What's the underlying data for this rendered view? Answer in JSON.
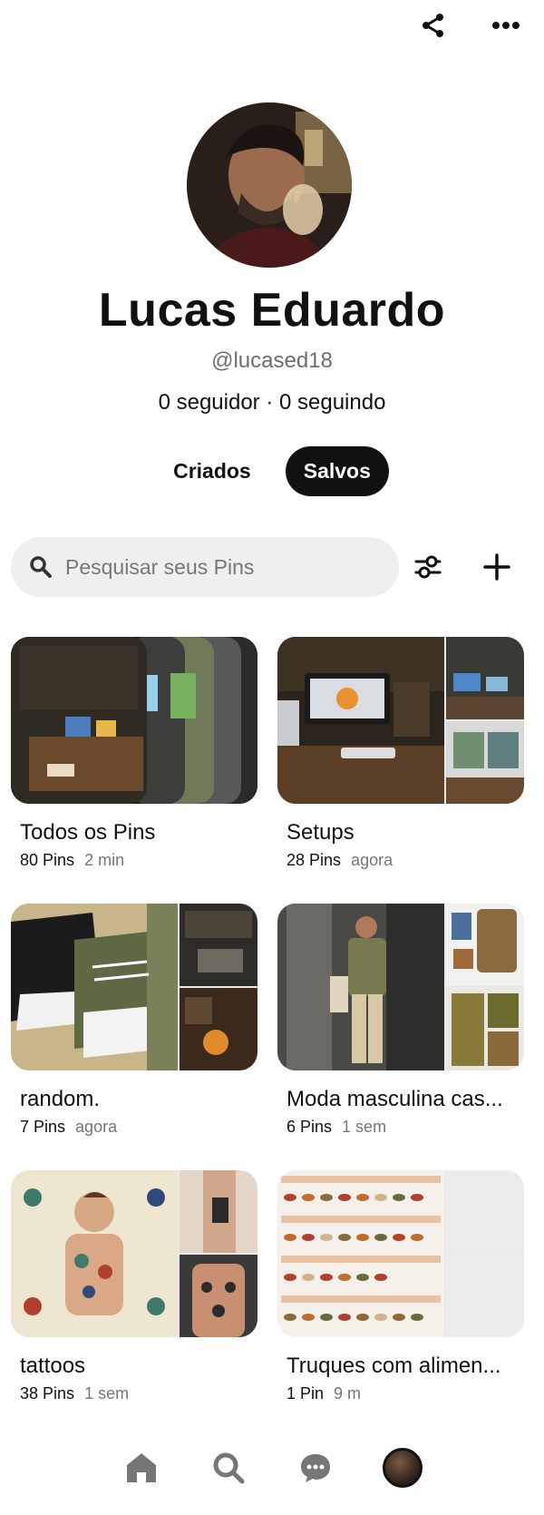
{
  "header": {
    "share_icon": "share-icon",
    "more_icon": "more-icon"
  },
  "profile": {
    "name": "Lucas Eduardo",
    "handle": "@lucased18",
    "follows": "0 seguidor · 0 seguindo"
  },
  "tabs": [
    {
      "label": "Criados",
      "active": false
    },
    {
      "label": "Salvos",
      "active": true
    }
  ],
  "search": {
    "placeholder": "Pesquisar seus Pins",
    "value": ""
  },
  "boards": [
    {
      "title": "Todos os Pins",
      "count": "80 Pins",
      "time": "2 min"
    },
    {
      "title": "Setups",
      "count": "28 Pins",
      "time": "agora"
    },
    {
      "title": "random.",
      "count": "7 Pins",
      "time": "agora"
    },
    {
      "title": "Moda masculina cas...",
      "count": "6 Pins",
      "time": "1 sem"
    },
    {
      "title": "tattoos",
      "count": "38 Pins",
      "time": "1 sem"
    },
    {
      "title": "Truques com alimen...",
      "count": "1 Pin",
      "time": "9 m"
    }
  ],
  "nav": {
    "home_icon": "home-icon",
    "search_icon": "search-icon",
    "messages_icon": "chat-icon",
    "profile_icon": "avatar"
  }
}
